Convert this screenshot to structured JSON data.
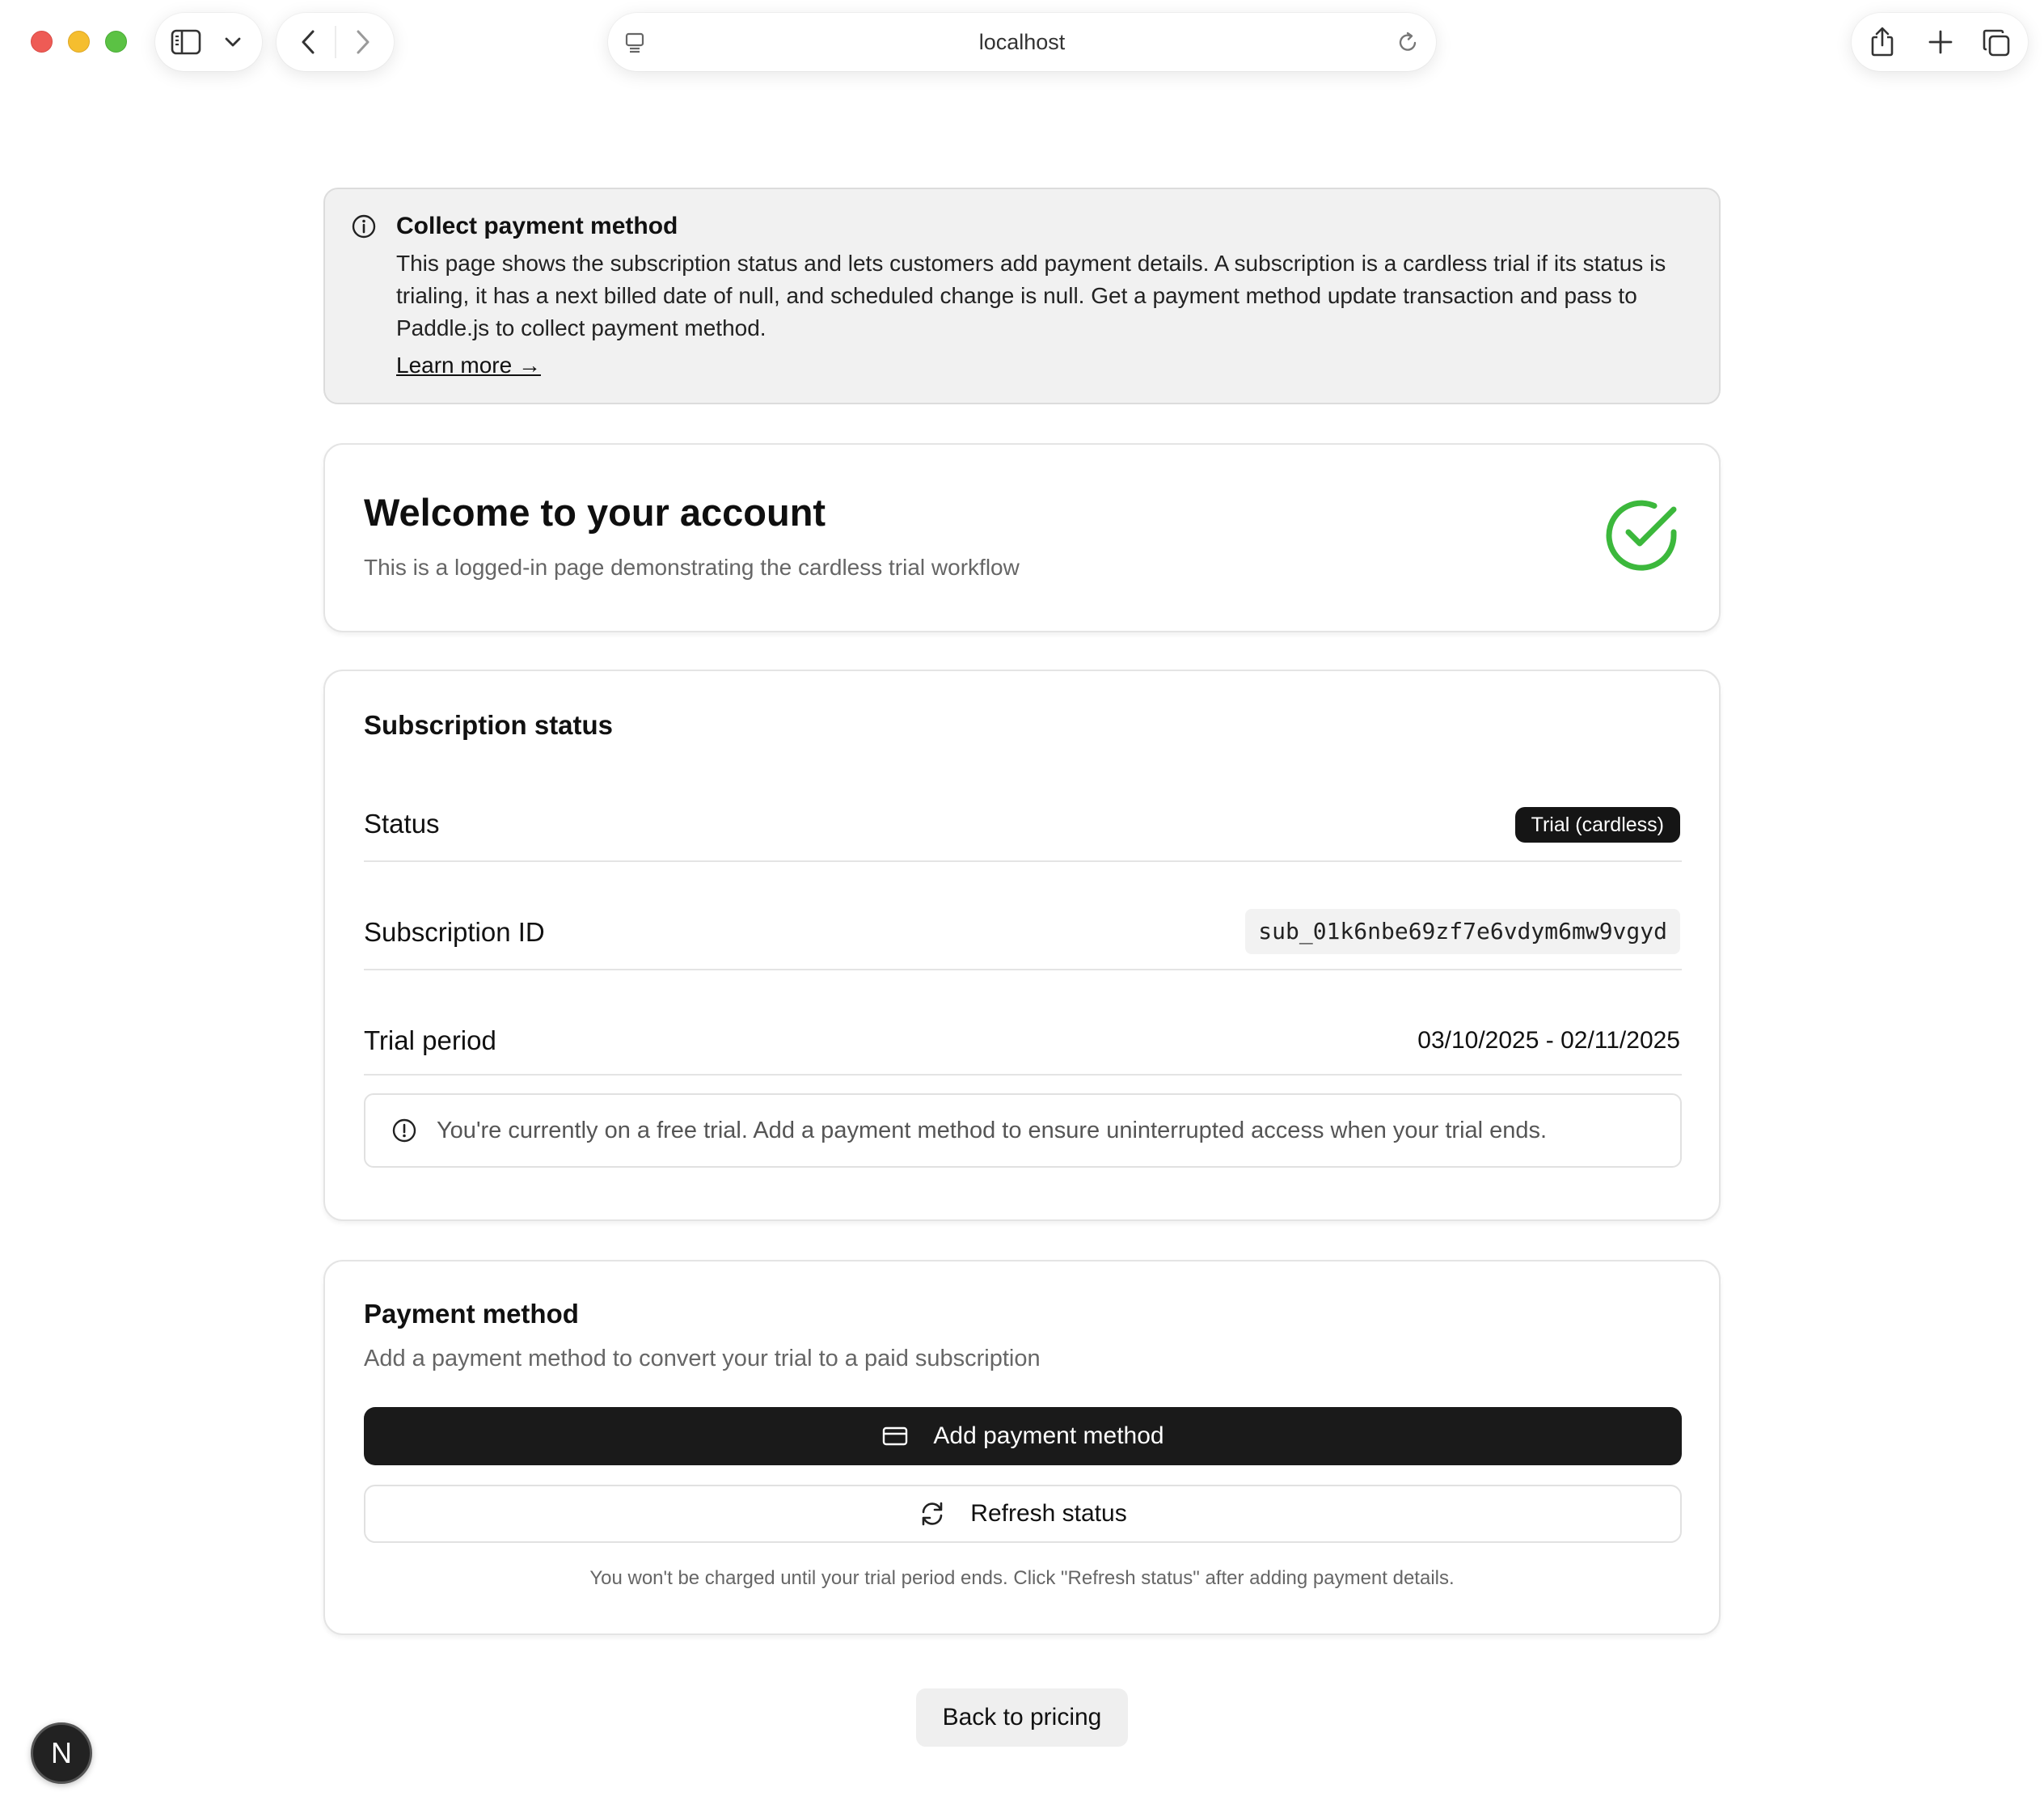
{
  "browser": {
    "url": "localhost",
    "icons": [
      "sidebar-toggle-icon",
      "chevron-down-icon",
      "back-arrow-icon",
      "forward-arrow-icon",
      "site-settings-icon",
      "reload-icon",
      "share-icon",
      "new-tab-icon",
      "tabs-overview-icon"
    ]
  },
  "notice": {
    "icon": "info-icon",
    "title": "Collect payment method",
    "body": "This page shows the subscription status and lets customers add payment details. A subscription is a cardless trial if its status is trialing, it has a next billed date of null, and scheduled change is null. Get a payment method update transaction and pass to Paddle.js to collect payment method.",
    "link": "Learn more →"
  },
  "welcome": {
    "title": "Welcome to your account",
    "subtitle": "This is a logged-in page demonstrating the cardless trial workflow",
    "icon": "check-circle-icon",
    "accent": "#3cb83c"
  },
  "subscription": {
    "title": "Subscription status",
    "status_label": "Status",
    "status_value": "Trial (cardless)",
    "id_label": "Subscription ID",
    "id_value": "sub_01k6nbe69zf7e6vdym6mw9vgyd",
    "trial_label": "Trial period",
    "trial_value": "03/10/2025 - 02/11/2025",
    "alert_icon": "alert-circle-icon",
    "alert_text": "You're currently on a free trial. Add a payment method to ensure uninterrupted access when your trial ends."
  },
  "payment": {
    "title": "Payment method",
    "subtitle": "Add a payment method to convert your trial to a paid subscription",
    "add_label": "Add payment method",
    "add_icon": "credit-card-icon",
    "refresh_label": "Refresh status",
    "refresh_icon": "refresh-icon",
    "footnote": "You won't be charged until your trial period ends. Click \"Refresh status\" after adding payment details."
  },
  "back_label": "Back to pricing",
  "dev_badge": "N"
}
